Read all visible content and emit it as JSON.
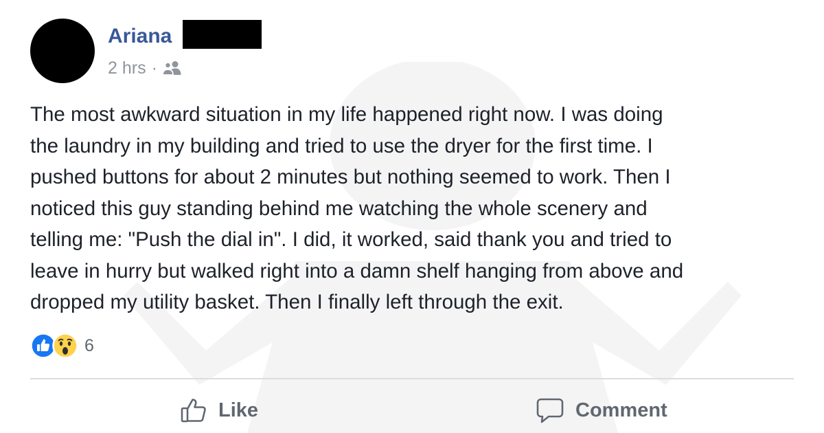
{
  "post": {
    "author": "Ariana",
    "timestamp": "2 hrs",
    "separator": "·",
    "audience_icon": "friends-icon",
    "body": "The most awkward situation in my life happened right now. I was doing\nthe laundry in my building and tried to use the dryer for the first time. I\npushed buttons for about 2 minutes but nothing seemed to work. Then I\nnoticed this guy standing behind me watching the whole scenery and\ntelling me: \"Push the dial in\". I did, it worked, said thank you and tried to\nleave in hurry but walked right into a damn shelf hanging from above and\ndropped my utility basket. Then I finally left through the exit.",
    "reactions": {
      "icons": [
        "like-reaction-icon",
        "wow-reaction-icon"
      ],
      "count": "6"
    },
    "actions": {
      "like_label": "Like",
      "comment_label": "Comment"
    }
  },
  "colors": {
    "author_name": "#385898",
    "meta_text": "#90949c",
    "body_text": "#1d2129",
    "action_text": "#606770",
    "like_blue": "#1877f2",
    "wow_yellow": "#ffd24c",
    "divider": "#dadde1"
  }
}
